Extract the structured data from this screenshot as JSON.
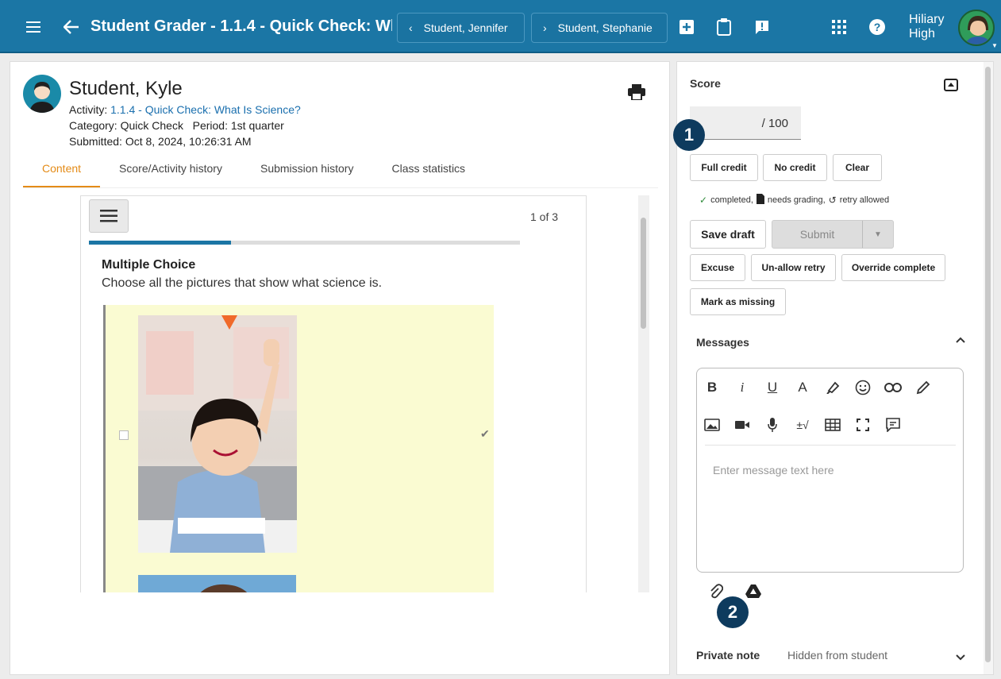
{
  "topbar": {
    "title": "Student Grader - 1.1.4 - Quick Check: Wh...",
    "prev_student": "Student, Jennifer",
    "next_student": "Student, Stephanie",
    "school": "Hiliary High"
  },
  "student": {
    "name": "Student, Kyle",
    "activity_label": "Activity:",
    "activity_link": "1.1.4 - Quick Check: What Is Science?",
    "category": "Category: Quick Check",
    "period": "Period: 1st quarter",
    "submitted": "Submitted: Oct 8, 2024, 10:26:31 AM"
  },
  "tabs": [
    {
      "label": "Content"
    },
    {
      "label": "Score/Activity history"
    },
    {
      "label": "Submission history"
    },
    {
      "label": "Class statistics"
    }
  ],
  "question": {
    "pager": "1 of 3",
    "progress": 0.33,
    "type": "Multiple Choice",
    "prompt": "Choose all the pictures that show what science is."
  },
  "score": {
    "label": "Score",
    "value": "/ 100",
    "full_credit": "Full credit",
    "no_credit": "No credit",
    "clear": "Clear",
    "status_completed": "completed,",
    "status_needs_grading": "needs grading,",
    "status_retry": "retry allowed",
    "save_draft": "Save draft",
    "submit": "Submit",
    "excuse": "Excuse",
    "unallow_retry": "Un-allow retry",
    "override_complete": "Override complete",
    "mark_missing": "Mark as missing"
  },
  "messages": {
    "label": "Messages",
    "placeholder": "Enter message text here"
  },
  "private_note": {
    "label": "Private note",
    "hint": "Hidden from student"
  },
  "badges": {
    "one": "1",
    "two": "2"
  }
}
